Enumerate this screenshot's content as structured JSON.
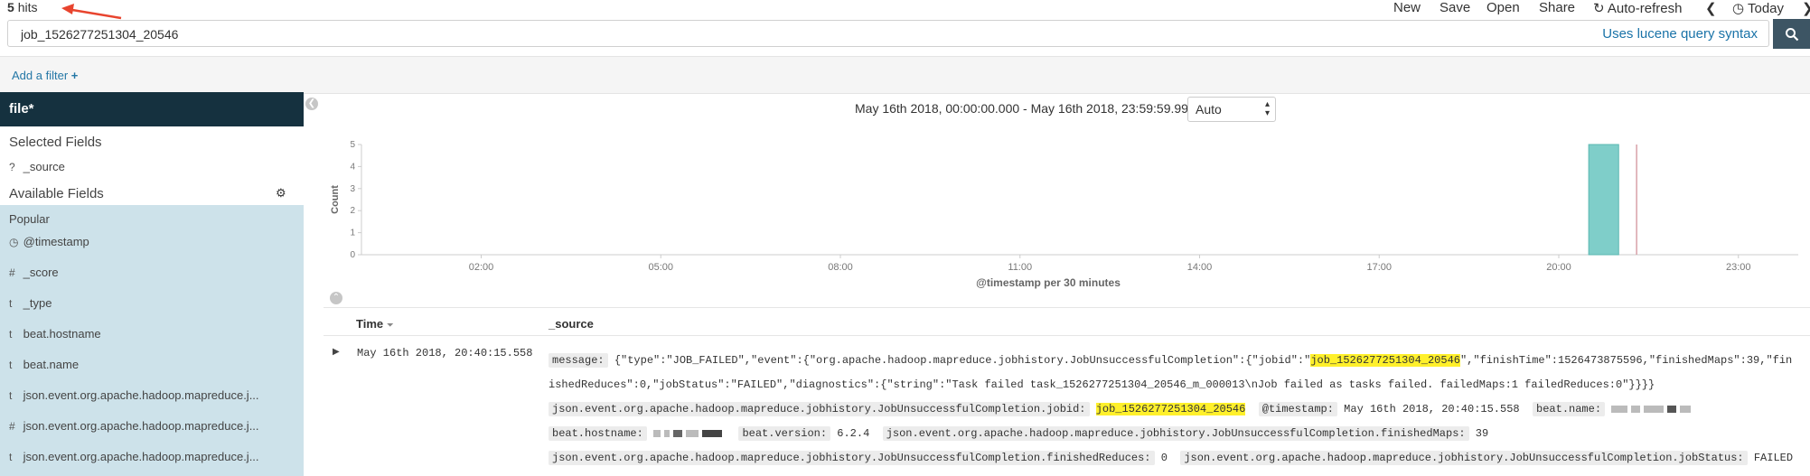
{
  "top": {
    "hits_count": "5",
    "hits_label": "hits",
    "menu": [
      "New",
      "Save",
      "Open",
      "Share",
      "Auto-refresh",
      "Today"
    ]
  },
  "search": {
    "query": "job_1526277251304_20546",
    "syntax_link": "Uses lucene query syntax"
  },
  "filter": {
    "add_label": "Add a filter"
  },
  "sidebar": {
    "index_name": "file*",
    "selected_title": "Selected Fields",
    "selected_fields": [
      {
        "type": "?",
        "name": "_source"
      }
    ],
    "available_title": "Available Fields",
    "popular_label": "Popular",
    "fields": [
      {
        "type": "clock",
        "name": "@timestamp"
      },
      {
        "type": "#",
        "name": "_score"
      },
      {
        "type": "t",
        "name": "_type"
      },
      {
        "type": "t",
        "name": "beat.hostname"
      },
      {
        "type": "t",
        "name": "beat.name"
      },
      {
        "type": "t",
        "name": "json.event.org.apache.hadoop.mapreduce.j..."
      },
      {
        "type": "#",
        "name": "json.event.org.apache.hadoop.mapreduce.j..."
      },
      {
        "type": "t",
        "name": "json.event.org.apache.hadoop.mapreduce.j..."
      }
    ]
  },
  "histogram": {
    "date_range": "May 16th 2018, 00:00:00.000 - May 16th 2018, 23:59:59.999 —",
    "interval": "Auto"
  },
  "chart_data": {
    "type": "bar",
    "xlabel": "@timestamp per 30 minutes",
    "ylabel": "Count",
    "ylim": [
      0,
      5
    ],
    "yticks": [
      "0",
      "1",
      "2",
      "3",
      "4",
      "5"
    ],
    "xticks": [
      "02:00",
      "05:00",
      "08:00",
      "11:00",
      "14:00",
      "17:00",
      "20:00",
      "23:00"
    ],
    "x_range_hours": [
      0,
      24
    ],
    "bars": [
      {
        "x": "20:30",
        "x_hours": 20.5,
        "value": 5
      }
    ],
    "now_marker_hours": 21.3,
    "bar_color": "#7fcec9"
  },
  "results": {
    "col_time": "Time",
    "col_source": "_source",
    "rows": [
      {
        "time": "May 16th 2018, 20:40:15.558",
        "message_key": "message:",
        "message_pre": "{\"type\":\"JOB_FAILED\",\"event\":{\"org.apache.hadoop.mapreduce.jobhistory.JobUnsuccessfulCompletion\":{\"jobid\":\"",
        "message_hl": "job_1526277251304_20546",
        "message_post_1": "\",\"finishTime\":1526473875596,\"finishedMaps\":39,\"fin",
        "message_post_2": "ishedReduces\":0,\"jobStatus\":\"FAILED\",\"diagnostics\":{\"string\":\"Task failed task_1526277251304_20546_m_000013\\nJob failed as tasks failed. failedMaps:1 failedReduces:0\"}}}}",
        "jobid_key": "json.event.org.apache.hadoop.mapreduce.jobhistory.JobUnsuccessfulCompletion.jobid:",
        "jobid_val": "job_1526277251304_20546",
        "ts_key": "@timestamp:",
        "ts_val": "May 16th 2018, 20:40:15.558",
        "beatname_key": "beat.name:",
        "hostname_key": "beat.hostname:",
        "version_key": "beat.version:",
        "version_val": "6.2.4",
        "fmaps_key": "json.event.org.apache.hadoop.mapreduce.jobhistory.JobUnsuccessfulCompletion.finishedMaps:",
        "fmaps_val": "39",
        "freduces_key": "json.event.org.apache.hadoop.mapreduce.jobhistory.JobUnsuccessfulCompletion.finishedReduces:",
        "freduces_val": "0",
        "jstatus_key": "json.event.org.apache.hadoop.mapreduce.jobhistory.JobUnsuccessfulCompletion.jobStatus:",
        "jstatus_val": "FAILED"
      }
    ]
  }
}
